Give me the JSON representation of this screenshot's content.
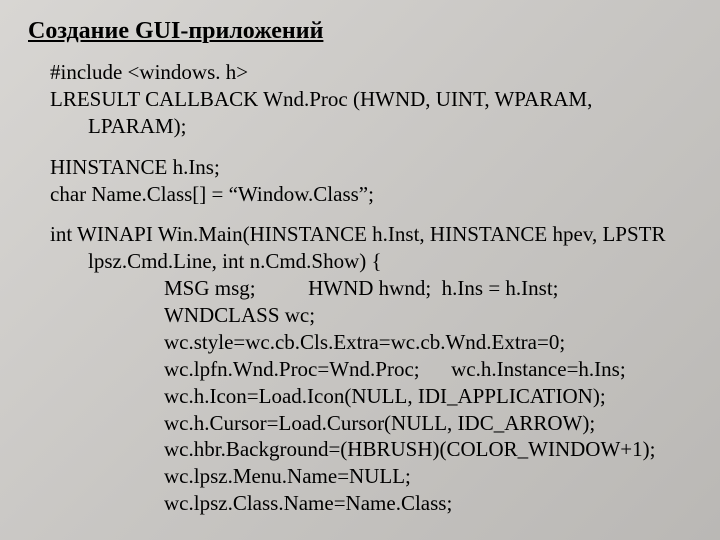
{
  "title": "Создание GUI-приложений",
  "code": {
    "p1l1": "#include <windows. h>",
    "p1l2": "LRESULT CALLBACK Wnd.Proc (HWND, UINT, WPARAM, LPARAM);",
    "p2l1": "HINSTANCE h.Ins;",
    "p2l2": "char Name.Class[] = “Window.Class”;",
    "p3l1": "int WINAPI Win.Main(HINSTANCE h.Inst, HINSTANCE hpev, LPSTR lpsz.Cmd.Line, int n.Cmd.Show) {",
    "p3l2": "MSG msg;          HWND hwnd;  h.Ins = h.Inst;",
    "p3l3": "WNDCLASS wc;",
    "p3l4": "wc.style=wc.cb.Cls.Extra=wc.cb.Wnd.Extra=0;",
    "p3l5": "wc.lpfn.Wnd.Proc=Wnd.Proc;      wc.h.Instance=h.Ins;",
    "p3l6": "wc.h.Icon=Load.Icon(NULL, IDI_APPLICATION);",
    "p3l7": "wc.h.Cursor=Load.Cursor(NULL, IDC_ARROW);",
    "p3l8": "wc.hbr.Background=(HBRUSH)(COLOR_WINDOW+1);",
    "p3l9": "wc.lpsz.Menu.Name=NULL;",
    "p3l10": "wc.lpsz.Class.Name=Name.Class;"
  }
}
